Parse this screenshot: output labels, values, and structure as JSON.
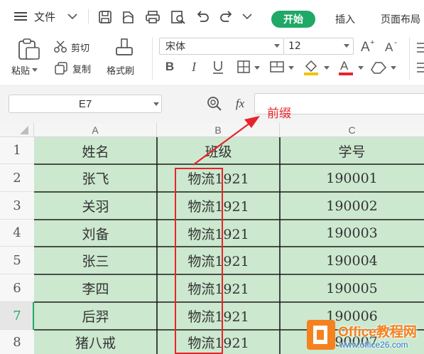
{
  "menu": {
    "file_label": "文件",
    "tabs": [
      "开始",
      "插入",
      "页面布局"
    ]
  },
  "clipboard": {
    "paste_label": "粘贴",
    "cut_label": "剪切",
    "copy_label": "复制",
    "format_painter_label": "格式刷"
  },
  "font": {
    "name": "宋体",
    "size": "12"
  },
  "formula_bar": {
    "name_box": "E7",
    "fx_label": "fx",
    "formula_value": ""
  },
  "annotation": {
    "text": "前缀",
    "color": "#e8232a"
  },
  "sheet": {
    "columns": [
      "A",
      "B",
      "C"
    ],
    "row_numbers": [
      "1",
      "2",
      "3",
      "4",
      "5",
      "6",
      "7",
      "8"
    ],
    "header": [
      "姓名",
      "班级",
      "学号"
    ],
    "rows": [
      [
        "张飞",
        "物流1921",
        "190001"
      ],
      [
        "关羽",
        "物流1921",
        "190002"
      ],
      [
        "刘备",
        "物流1921",
        "190003"
      ],
      [
        "张三",
        "物流1921",
        "190004"
      ],
      [
        "李四",
        "物流1921",
        "190005"
      ],
      [
        "后羿",
        "物流1921",
        "190006"
      ],
      [
        "猪八戒",
        "物流1921",
        "190007"
      ]
    ],
    "cell_fill": "#cce8cf",
    "active_row": "7"
  },
  "watermark": {
    "brand": "Office教程网",
    "url": "www.office26.com"
  },
  "colors": {
    "accent_green": "#1fa866",
    "annotation_red": "#e8232a",
    "cell_green": "#cce8cf"
  }
}
